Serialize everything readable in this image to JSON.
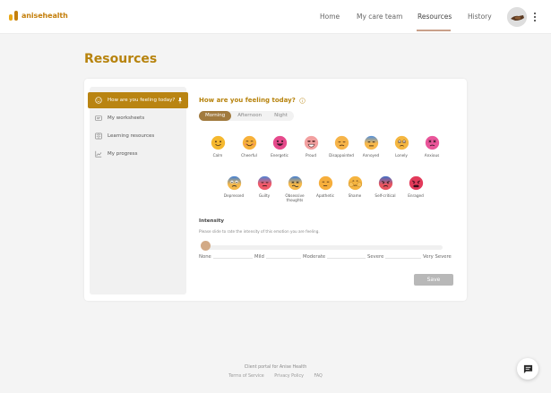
{
  "brand": {
    "name": "anisehealth"
  },
  "nav": {
    "items": [
      "Home",
      "My care team",
      "Resources",
      "History"
    ],
    "active": "Resources"
  },
  "page": {
    "title": "Resources"
  },
  "sidebar": {
    "items": [
      {
        "label": "How are you feeling today?",
        "icon": "smiley-icon",
        "active": true
      },
      {
        "label": "My worksheets",
        "icon": "worksheet-icon",
        "active": false
      },
      {
        "label": "Learning resources",
        "icon": "book-icon",
        "active": false
      },
      {
        "label": "My progress",
        "icon": "chart-icon",
        "active": false
      }
    ]
  },
  "feeling": {
    "title": "How are you feeling today?",
    "times": [
      "Morning",
      "Afternoon",
      "Night"
    ],
    "active_time": "Morning",
    "emotions": [
      "Calm",
      "Cheerful",
      "Energetic",
      "Proud",
      "Disappointed",
      "Annoyed",
      "Lonely",
      "Anxious",
      "Depressed",
      "Guilty",
      "Obsessive thoughts",
      "Apathetic",
      "Shame",
      "Self-critical",
      "Enraged"
    ]
  },
  "intensity": {
    "title": "Intensity",
    "help": "Please slide to rate the intensity of this emotion you are feeling.",
    "levels": [
      "None",
      "Mild",
      "Moderate",
      "Severe",
      "Very Severe"
    ],
    "value": 0
  },
  "actions": {
    "save": "Save"
  },
  "footer": {
    "title": "Client portal for Anise Health",
    "links": [
      "Terms of Service",
      "Privacy Policy",
      "FAQ"
    ]
  },
  "colors": {
    "accent": "#b7830d",
    "active_tab": "#a17a3e",
    "save_disabled": "#b8b8b8"
  }
}
